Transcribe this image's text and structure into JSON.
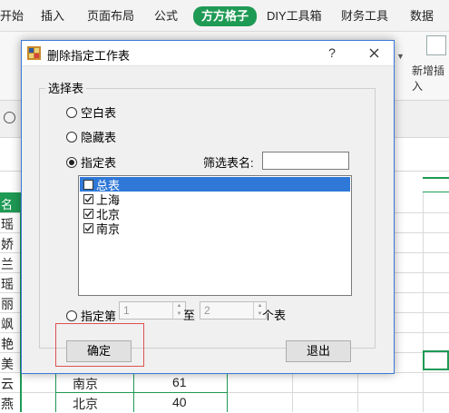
{
  "excel": {
    "tabs": [
      "开始",
      "插入",
      "页面布局",
      "公式",
      "方方格子",
      "DIY工具箱",
      "财务工具",
      "数据"
    ],
    "active_tab": "方方格子",
    "ribbon_right_label": "新增插入",
    "column_header": "名",
    "left_cells": [
      "瑶",
      "娇",
      "兰",
      "瑶",
      "丽",
      "飒",
      "艳",
      "美",
      "云",
      "燕"
    ],
    "rows": [
      {
        "city": "南京",
        "value": "61"
      },
      {
        "city": "北京",
        "value": "40"
      }
    ],
    "colors": {
      "accent": "#1f9a55"
    }
  },
  "dialog": {
    "title": "删除指定工作表",
    "help_label": "?",
    "close_icon": "close-icon",
    "group_label": "选择表",
    "options": {
      "blank": "空白表",
      "hidden": "隐藏表",
      "specified": "指定表",
      "range": "指定第"
    },
    "selected_option": "specified",
    "filter_label": "筛选表名:",
    "filter_value": "",
    "sheets": [
      {
        "name": "总表",
        "checked": false,
        "selected": true
      },
      {
        "name": "上海",
        "checked": true,
        "selected": false
      },
      {
        "name": "北京",
        "checked": true,
        "selected": false
      },
      {
        "name": "南京",
        "checked": true,
        "selected": false
      }
    ],
    "range_from": "1",
    "range_to_label": "至",
    "range_to": "2",
    "range_suffix": "个表",
    "ok_label": "确定",
    "cancel_label": "退出",
    "highlight_color": "#e0504f"
  }
}
